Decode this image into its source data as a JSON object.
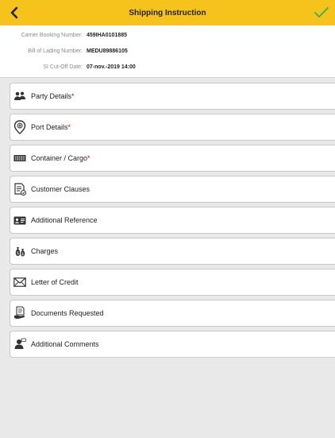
{
  "header": {
    "title": "Shipping Instruction",
    "back_icon": "chevron-left-icon",
    "confirm_icon": "checkmark-icon",
    "accent_color": "#f6c31c",
    "check_color": "#4caf50"
  },
  "info": {
    "carrier_booking_label": "Carrier Booking Number:",
    "carrier_booking_value": "459IHA0101885",
    "bill_of_lading_label": "Bill of Lading Number:",
    "bill_of_lading_value": "MEDU89886105",
    "si_cutoff_label": "SI Cut-Off Date:",
    "si_cutoff_value": "07-nov.-2019 14:00"
  },
  "menu": {
    "required_marker": "*",
    "required_color": "#d40000",
    "items": [
      {
        "label": "Party Details",
        "required": true,
        "icon": "people-icon"
      },
      {
        "label": "Port Details",
        "required": true,
        "icon": "location-pin-icon"
      },
      {
        "label": "Container / Cargo",
        "required": true,
        "icon": "container-icon"
      },
      {
        "label": "Customer Clauses",
        "required": false,
        "icon": "document-edit-icon"
      },
      {
        "label": "Additional Reference",
        "required": false,
        "icon": "id-card-icon"
      },
      {
        "label": "Charges",
        "required": false,
        "icon": "money-bags-icon"
      },
      {
        "label": "Letter of Credit",
        "required": false,
        "icon": "envelope-icon"
      },
      {
        "label": "Documents Requested",
        "required": false,
        "icon": "document-hand-icon"
      },
      {
        "label": "Additional Comments",
        "required": false,
        "icon": "person-comment-icon"
      }
    ]
  }
}
